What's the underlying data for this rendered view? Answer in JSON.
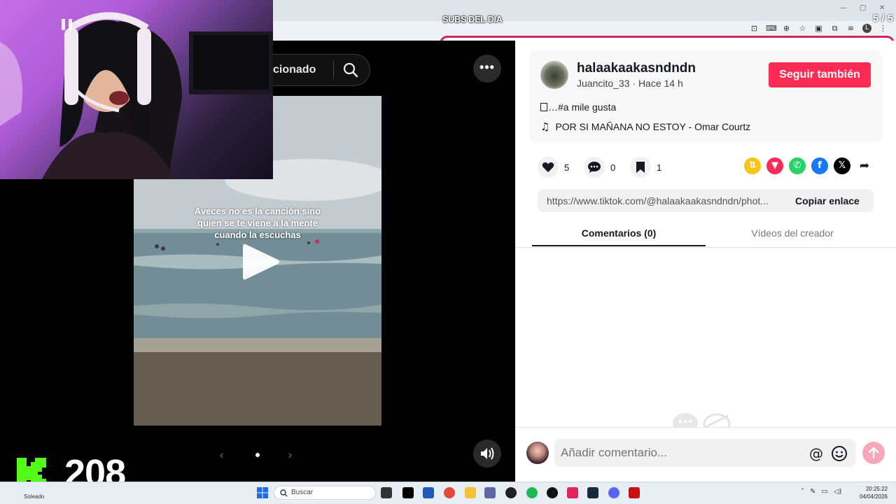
{
  "overlay": {
    "subs_title": "SUBS DEL DIA",
    "subs_counter": "5 / 5",
    "k_value": "208"
  },
  "browser": {
    "window_controls": [
      "—",
      "▢",
      "✕"
    ],
    "toolbar_icons": [
      "install-icon",
      "translate-icon",
      "zoom-icon",
      "bookmark-star-icon",
      "extension-icon",
      "puzzle-icon",
      "reading-list-icon",
      "profile-icon",
      "menu-icon"
    ],
    "profile_initial": "L"
  },
  "media": {
    "search_label": "cionado",
    "caption_lines": [
      "Aveces no es la canción sino",
      "quien se te viene a la mente",
      "cuando la escuchas"
    ],
    "nav_prev": "‹",
    "nav_next": "›",
    "more_label": "•••"
  },
  "post": {
    "username": "halaakaakasndndn",
    "subline": "Juancito_33 · Hace 14 h",
    "follow_label": "Seguir también",
    "description": "…#a mile gusta",
    "music": "POR SI MAÑANA NO ESTOY - Omar Courtz",
    "likes": "5",
    "comments": "0",
    "saves": "1",
    "link": "https://www.tiktok.com/@halaakaakasndndn/phot...",
    "copy_label": "Copiar enlace",
    "tabs": [
      {
        "label": "Comentarios (0)",
        "active": true
      },
      {
        "label": "Vídeos del creador",
        "active": false
      }
    ],
    "comment_placeholder": "Añadir comentario...",
    "at_symbol": "@",
    "share_colors": {
      "repost": "#f5c518",
      "send": "#fe2c55",
      "whatsapp": "#25d366",
      "facebook": "#1877f2",
      "x": "#000000"
    },
    "accent": "#fe2c55"
  },
  "taskbar": {
    "weather": "Soleado",
    "search_label": "Buscar",
    "time": "20:25:22",
    "date": "04/04/2026"
  }
}
